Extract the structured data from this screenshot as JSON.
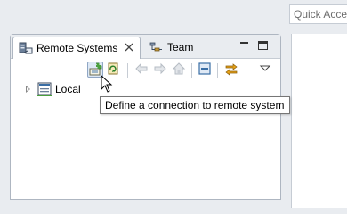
{
  "quick_access": {
    "text": "Quick Acces"
  },
  "view": {
    "tabs": [
      {
        "label": "Remote Systems",
        "icon": "remote-systems-icon",
        "closable": true,
        "active": true
      },
      {
        "label": "Team",
        "icon": "team-icon",
        "active": false
      }
    ],
    "toolbar": [
      {
        "icon": "define-connection-icon"
      },
      {
        "icon": "refresh-connection-icon"
      },
      {
        "icon": "back-arrow-icon",
        "enabled": false
      },
      {
        "icon": "forward-arrow-icon",
        "enabled": false
      },
      {
        "icon": "home-icon",
        "enabled": false
      },
      {
        "icon": "collapse-all-icon"
      },
      {
        "icon": "link-with-editor-icon"
      },
      {
        "icon": "view-menu-icon"
      }
    ],
    "tree": [
      {
        "label": "Local",
        "icon": "local-system-icon",
        "expanded": false
      }
    ]
  },
  "tooltip": {
    "text": "Define a connection to remote system"
  },
  "colors": {
    "accent": "#3a6ea5",
    "highlight": "#dde8f5"
  }
}
